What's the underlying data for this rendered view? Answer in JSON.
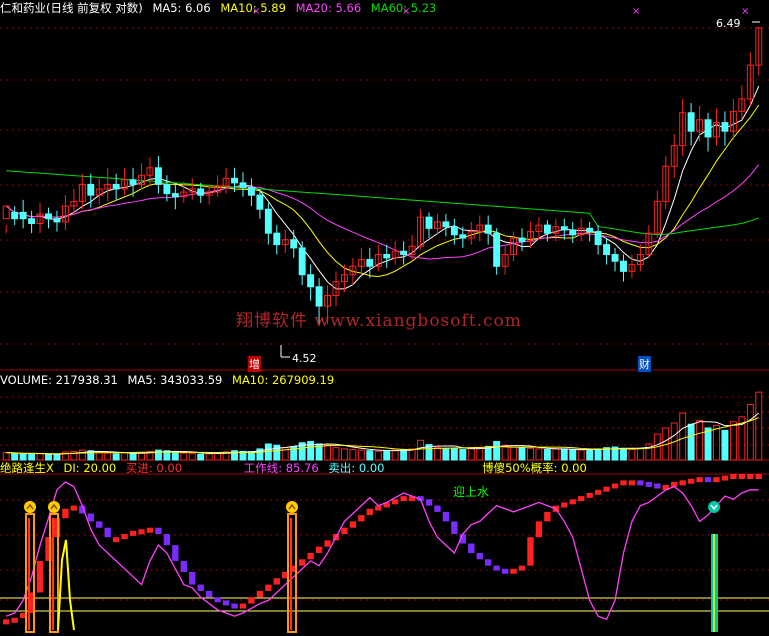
{
  "colors": {
    "white": "#ffffff",
    "yellow": "#ffff00",
    "magenta": "#ff40ff",
    "green": "#00dd00",
    "red": "#ff2020",
    "cyan": "#54ffff",
    "purple": "#7a2cff",
    "grid": "#8b0000",
    "orange": "#ff9a00"
  },
  "main_header": {
    "title": "仁和药业(日线 前复权 对数)",
    "ma5": "MA5: 6.06",
    "ma10": "MA10: 5.89",
    "ma20": "MA20: 5.66",
    "ma60": "MA60: 5.23"
  },
  "volume_header": {
    "volume": "VOLUME: 217938.31",
    "ma5": "MA5: 343033.59",
    "ma10": "MA10: 267909.19"
  },
  "indicator_header": {
    "name": "绝路逢生X",
    "di": "DI: 20.00",
    "buy": "买进: 0.00",
    "work": "工作线: 85.76",
    "sell": "卖出: 0.00",
    "prob": "博傻50%概率: 0.00"
  },
  "annotations": {
    "high_price": "6.49",
    "low_price": "4.52",
    "tag_zeng": "增",
    "tag_cai": "财",
    "tag_water": "迎上水"
  },
  "watermark": "翔博软件 www.xiangbosoft.com",
  "chart_data": [
    {
      "type": "candlestick",
      "title": "仁和药业(日线 前复权 对数)",
      "series_names": [
        "MA5",
        "MA10",
        "MA20",
        "MA60"
      ],
      "ylim": [
        4.4,
        6.6
      ],
      "log_scale": true,
      "annotations": [
        {
          "label": "6.49",
          "kind": "high"
        },
        {
          "label": "4.52",
          "kind": "low"
        }
      ],
      "candles": [
        [
          5.14,
          5.22,
          5.1,
          5.05
        ],
        [
          5.18,
          5.14,
          5.22,
          5.1
        ],
        [
          5.18,
          5.14,
          5.26,
          5.08
        ],
        [
          5.14,
          5.11,
          5.19,
          5.05
        ],
        [
          5.11,
          5.17,
          5.24,
          5.05
        ],
        [
          5.17,
          5.14,
          5.21,
          5.08
        ],
        [
          5.14,
          5.12,
          5.19,
          5.06
        ],
        [
          5.12,
          5.22,
          5.29,
          5.07
        ],
        [
          5.22,
          5.25,
          5.33,
          5.16
        ],
        [
          5.25,
          5.36,
          5.43,
          5.2
        ],
        [
          5.36,
          5.29,
          5.43,
          5.21
        ],
        [
          5.29,
          5.33,
          5.4,
          5.23
        ],
        [
          5.33,
          5.36,
          5.47,
          5.25
        ],
        [
          5.36,
          5.33,
          5.43,
          5.26
        ],
        [
          5.33,
          5.39,
          5.47,
          5.29
        ],
        [
          5.39,
          5.36,
          5.47,
          5.28
        ],
        [
          5.36,
          5.42,
          5.5,
          5.33
        ],
        [
          5.42,
          5.47,
          5.54,
          5.35
        ],
        [
          5.47,
          5.36,
          5.55,
          5.3
        ],
        [
          5.36,
          5.3,
          5.42,
          5.25
        ],
        [
          5.3,
          5.28,
          5.36,
          5.2
        ],
        [
          5.28,
          5.31,
          5.38,
          5.24
        ],
        [
          5.31,
          5.33,
          5.4,
          5.26
        ],
        [
          5.33,
          5.29,
          5.37,
          5.24
        ],
        [
          5.29,
          5.31,
          5.36,
          5.23
        ],
        [
          5.31,
          5.35,
          5.42,
          5.28
        ],
        [
          5.35,
          5.4,
          5.47,
          5.3
        ],
        [
          5.4,
          5.37,
          5.47,
          5.31
        ],
        [
          5.37,
          5.34,
          5.44,
          5.28
        ],
        [
          5.34,
          5.29,
          5.4,
          5.22
        ],
        [
          5.29,
          5.2,
          5.33,
          5.14
        ],
        [
          5.2,
          5.05,
          5.24,
          4.98
        ],
        [
          5.05,
          4.98,
          5.1,
          4.92
        ],
        [
          4.98,
          5.01,
          5.07,
          4.93
        ],
        [
          5.01,
          4.96,
          5.07,
          4.9
        ],
        [
          4.96,
          4.8,
          5.0,
          4.74
        ],
        [
          4.8,
          4.73,
          4.86,
          4.65
        ],
        [
          4.73,
          4.62,
          4.78,
          4.52
        ],
        [
          4.62,
          4.68,
          4.74,
          4.52
        ],
        [
          4.68,
          4.76,
          4.82,
          4.62
        ],
        [
          4.76,
          4.8,
          4.86,
          4.7
        ],
        [
          4.8,
          4.85,
          4.9,
          4.74
        ],
        [
          4.85,
          4.89,
          4.96,
          4.8
        ],
        [
          4.89,
          4.85,
          4.96,
          4.78
        ],
        [
          4.85,
          4.92,
          4.98,
          4.82
        ],
        [
          4.92,
          4.9,
          4.98,
          4.84
        ],
        [
          4.9,
          4.94,
          5.0,
          4.86
        ],
        [
          4.94,
          4.92,
          5.0,
          4.86
        ],
        [
          4.92,
          4.97,
          5.04,
          4.88
        ],
        [
          4.97,
          5.15,
          5.2,
          4.95
        ],
        [
          5.15,
          5.08,
          5.18,
          5.02
        ],
        [
          5.08,
          5.12,
          5.17,
          5.04
        ],
        [
          5.12,
          5.09,
          5.17,
          5.03
        ],
        [
          5.09,
          5.04,
          5.14,
          4.98
        ],
        [
          5.04,
          5.02,
          5.09,
          4.96
        ],
        [
          5.02,
          5.06,
          5.12,
          4.98
        ],
        [
          5.06,
          5.1,
          5.16,
          5.0
        ],
        [
          5.1,
          5.05,
          5.16,
          4.98
        ],
        [
          5.05,
          4.85,
          5.08,
          4.8
        ],
        [
          4.85,
          4.92,
          4.97,
          4.8
        ],
        [
          4.92,
          5.02,
          5.06,
          4.88
        ],
        [
          5.02,
          5.0,
          5.08,
          4.94
        ],
        [
          5.0,
          5.06,
          5.12,
          4.96
        ],
        [
          5.06,
          5.1,
          5.15,
          5.01
        ],
        [
          5.1,
          5.05,
          5.13,
          5.0
        ],
        [
          5.05,
          5.09,
          5.14,
          5.0
        ],
        [
          5.09,
          5.07,
          5.14,
          5.01
        ],
        [
          5.07,
          5.04,
          5.12,
          4.99
        ],
        [
          5.04,
          5.08,
          5.14,
          5.0
        ],
        [
          5.08,
          5.06,
          5.12,
          5.0
        ],
        [
          5.06,
          4.98,
          5.1,
          4.92
        ],
        [
          4.98,
          4.92,
          5.02,
          4.86
        ],
        [
          4.92,
          4.88,
          4.96,
          4.82
        ],
        [
          4.88,
          4.82,
          4.92,
          4.76
        ],
        [
          4.82,
          4.86,
          4.92,
          4.78
        ],
        [
          4.86,
          4.92,
          4.98,
          4.82
        ],
        [
          4.92,
          5.05,
          5.1,
          4.9
        ],
        [
          5.05,
          5.25,
          5.32,
          5.02
        ],
        [
          5.25,
          5.48,
          5.55,
          5.2
        ],
        [
          5.48,
          5.62,
          5.7,
          5.4
        ],
        [
          5.62,
          5.85,
          5.95,
          5.55
        ],
        [
          5.85,
          5.72,
          5.92,
          5.62
        ],
        [
          5.72,
          5.8,
          5.9,
          5.65
        ],
        [
          5.8,
          5.68,
          5.85,
          5.58
        ],
        [
          5.68,
          5.78,
          5.88,
          5.62
        ],
        [
          5.78,
          5.72,
          5.86,
          5.62
        ],
        [
          5.72,
          5.86,
          5.95,
          5.66
        ],
        [
          5.86,
          5.95,
          6.05,
          5.8
        ],
        [
          5.95,
          6.2,
          6.3,
          5.9
        ],
        [
          6.2,
          6.49,
          6.49,
          6.12
        ]
      ],
      "candle_order": "open,close,high,low"
    },
    {
      "type": "bar",
      "title": "VOLUME",
      "series_names": [
        "VOLUME",
        "MA5",
        "MA10"
      ],
      "values": [
        120,
        110,
        95,
        105,
        100,
        90,
        85,
        130,
        140,
        160,
        150,
        120,
        110,
        100,
        115,
        105,
        120,
        140,
        160,
        150,
        130,
        110,
        105,
        95,
        100,
        115,
        130,
        150,
        140,
        135,
        180,
        260,
        240,
        200,
        220,
        280,
        300,
        260,
        240,
        200,
        180,
        170,
        160,
        150,
        140,
        150,
        160,
        170,
        180,
        320,
        250,
        200,
        190,
        180,
        170,
        180,
        200,
        220,
        300,
        240,
        210,
        200,
        190,
        180,
        170,
        175,
        180,
        170,
        160,
        165,
        180,
        200,
        210,
        190,
        170,
        190,
        260,
        420,
        520,
        600,
        760,
        580,
        640,
        520,
        560,
        480,
        620,
        700,
        900,
        1100
      ],
      "ylim": [
        0,
        1200
      ]
    },
    {
      "type": "bar",
      "title": "绝路逢生X",
      "series_names": [
        "DI",
        "买进",
        "工作线",
        "卖出",
        "博傻50%概率"
      ],
      "annotations": [
        "迎上水"
      ]
    }
  ]
}
